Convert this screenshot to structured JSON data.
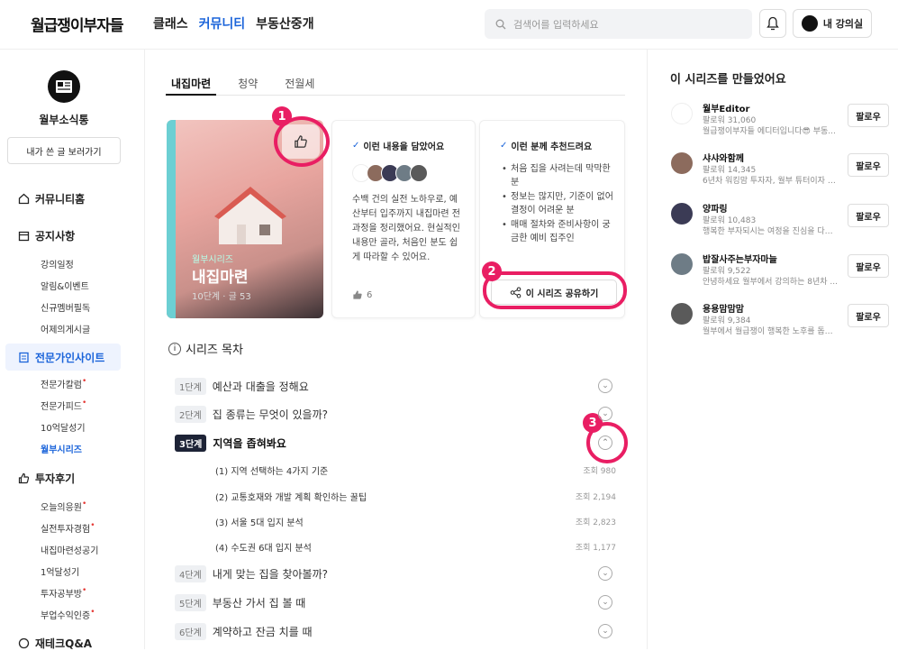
{
  "header": {
    "logo": "월급쟁이부자들",
    "nav": [
      "클래스",
      "커뮤니티",
      "부동산중개"
    ],
    "search_placeholder": "검색어를 입력하세요",
    "my_lecture": "내 강의실"
  },
  "sidebar": {
    "profile_name": "월부소식통",
    "my_posts_button": "내가 쓴 글 보러가기",
    "sections": [
      {
        "label": "커뮤니티홈",
        "items": []
      },
      {
        "label": "공지사항",
        "items": [
          {
            "label": "강의일정",
            "dot": false
          },
          {
            "label": "알림&이벤트",
            "dot": false
          },
          {
            "label": "신규멤버필독",
            "dot": false
          },
          {
            "label": "어제의게시글",
            "dot": false
          }
        ]
      },
      {
        "label": "전문가인사이트",
        "items": [
          {
            "label": "전문가칼럼",
            "dot": true
          },
          {
            "label": "전문가피드",
            "dot": true
          },
          {
            "label": "10억달성기",
            "dot": false
          },
          {
            "label": "월부시리즈",
            "dot": false
          }
        ]
      },
      {
        "label": "투자후기",
        "items": [
          {
            "label": "오늘의응원",
            "dot": true
          },
          {
            "label": "실전투자경험",
            "dot": true
          },
          {
            "label": "내집마련성공기",
            "dot": false
          },
          {
            "label": "1억달성기",
            "dot": false
          },
          {
            "label": "투자공부방",
            "dot": true
          },
          {
            "label": "부업수익인증",
            "dot": true
          }
        ]
      },
      {
        "label": "재테크Q&A",
        "items": []
      }
    ]
  },
  "tabs": [
    "내집마련",
    "청약",
    "전월세"
  ],
  "hero": {
    "category": "월부시리즈",
    "title": "내집마련",
    "meta": "10단계 · 글 53"
  },
  "card_content": {
    "title": "이런 내용을 담았어요",
    "description": "수백 건의 실전 노하우로, 예산부터 입주까지 내집마련 전 과정을 정리했어요. 현실적인 내용만 골라, 처음인 분도 쉽게 따라할 수 있어요.",
    "likes": "6"
  },
  "card_recommend": {
    "title": "이런 분께 추천드려요",
    "items": [
      "처음 집을 사려는데 막막한 분",
      "정보는 많지만, 기준이 없어 결정이 어려운 분",
      "매매 절차와 준비사항이 궁금한 예비 집주인"
    ],
    "share_button": "이 시리즈 공유하기"
  },
  "annotations": [
    "1",
    "2",
    "3"
  ],
  "toc": {
    "title": "시리즈 목차",
    "stages": [
      {
        "stage": "1단계",
        "title": "예산과 대출을 정해요"
      },
      {
        "stage": "2단계",
        "title": "집 종류는 무엇이 있을까?"
      },
      {
        "stage": "3단계",
        "title": "지역을 좁혀봐요"
      },
      {
        "stage": "4단계",
        "title": "내게 맞는 집을 찾아볼까?"
      },
      {
        "stage": "5단계",
        "title": "부동산 가서 집 볼 때"
      },
      {
        "stage": "6단계",
        "title": "계약하고 잔금 치를 때"
      }
    ],
    "sub_items": [
      {
        "title": "(1) 지역 선택하는 4가지 기준",
        "views": "조회 980"
      },
      {
        "title": "(2) 교통호재와 개발 계획 확인하는 꿀팁",
        "views": "조회 2,194"
      },
      {
        "title": "(3) 서울 5대 입지 분석",
        "views": "조회 2,823"
      },
      {
        "title": "(4) 수도권 6대 입지 분석",
        "views": "조회 1,177"
      }
    ]
  },
  "creators": {
    "title": "이 시리즈를 만들었어요",
    "follow_label": "팔로우",
    "list": [
      {
        "name": "월부Editor",
        "followers": "팔로워 31,060",
        "desc": "월급쟁이부자들 에디터입니다😎 부동..."
      },
      {
        "name": "샤샤와함께",
        "followers": "팔로워 14,345",
        "desc": "6년차 워킹맘 투자자, 월부 튜터이자 커..."
      },
      {
        "name": "양파링",
        "followers": "팔로워 10,483",
        "desc": "행복한 부자되시는 여정을 진심을 다해..."
      },
      {
        "name": "밥잘사주는부자마늘",
        "followers": "팔로워 9,522",
        "desc": "안녕하세요 월부에서 강의하는 8년차 ..."
      },
      {
        "name": "용용맘맘맘",
        "followers": "팔로워 9,384",
        "desc": "월부에서 월급쟁이 행복한 노후를 돕는..."
      }
    ]
  },
  "colors": {
    "accent": "#1b64da",
    "annotation": "#e91e63",
    "stage_dark": "#1d2336"
  }
}
